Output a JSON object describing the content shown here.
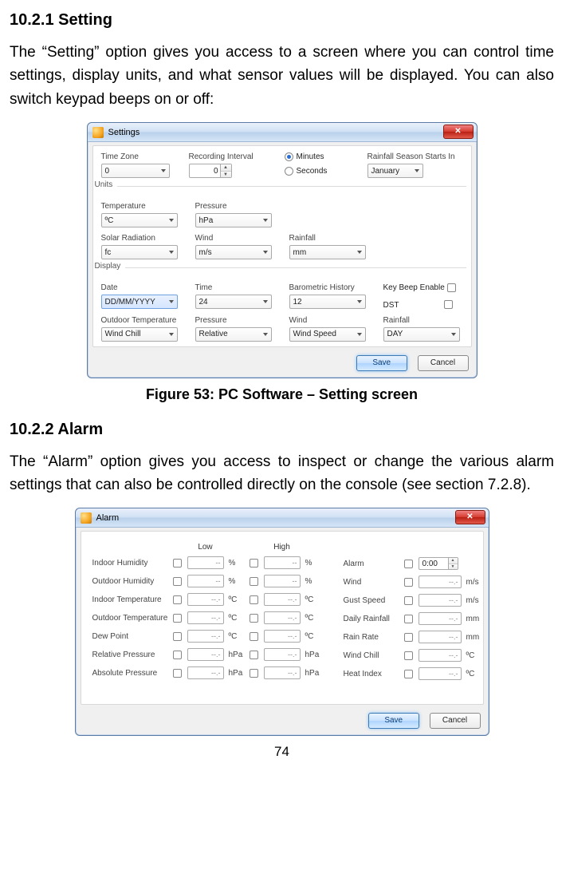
{
  "sections": {
    "setting": {
      "heading": "10.2.1 Setting",
      "paragraph": "The “Setting” option gives you access to a screen where you can control time settings, display units, and what sensor values will be displayed. You can also switch keypad beeps on or off:",
      "figcaption": "Figure 53: PC Software – Setting screen"
    },
    "alarm": {
      "heading": "10.2.2 Alarm",
      "paragraph": "The “Alarm” option gives you access to inspect or change the various alarm settings that can also be controlled directly on the console (see section 7.2.8)."
    }
  },
  "page_number": "74",
  "settings_window": {
    "title": "Settings",
    "close": "✕",
    "top": {
      "timezone_label": "Time Zone",
      "timezone_value": "0",
      "rec_interval_label": "Recording Interval",
      "rec_interval_value": "0",
      "minutes_label": "Minutes",
      "seconds_label": "Seconds",
      "rain_season_label": "Rainfall Season Starts In",
      "rain_season_value": "January"
    },
    "units": {
      "group_label": "Units",
      "temperature_label": "Temperature",
      "temperature_value": "ºC",
      "pressure_label": "Pressure",
      "pressure_value": "hPa",
      "solar_label": "Solar Radiation",
      "solar_value": "fc",
      "wind_label": "Wind",
      "wind_value": "m/s",
      "rainfall_label": "Rainfall",
      "rainfall_value": "mm"
    },
    "display": {
      "group_label": "Display",
      "date_label": "Date",
      "date_value": "DD/MM/YYYY",
      "time_label": "Time",
      "time_value": "24",
      "baro_label": "Barometric History",
      "baro_value": "12",
      "keybeep_label": "Key Beep Enable",
      "dst_label": "DST",
      "outdoor_temp_label": "Outdoor Temperature",
      "outdoor_temp_value": "Wind Chill",
      "pressure_label": "Pressure",
      "pressure_value": "Relative",
      "wind_label": "Wind",
      "wind_value": "Wind Speed",
      "rainfall_label": "Rainfall",
      "rainfall_value": "DAY"
    },
    "buttons": {
      "save": "Save",
      "cancel": "Cancel"
    }
  },
  "alarm_window": {
    "title": "Alarm",
    "close": "✕",
    "headers": {
      "low": "Low",
      "high": "High"
    },
    "placeholder_pct": "--",
    "placeholder_num": "--.-",
    "left_rows": [
      {
        "label": "Indoor Humidity",
        "unit": "%"
      },
      {
        "label": "Outdoor Humidity",
        "unit": "%"
      },
      {
        "label": "Indoor Temperature",
        "unit": "ºC"
      },
      {
        "label": "Outdoor Temperature",
        "unit": "ºC"
      },
      {
        "label": "Dew Point",
        "unit": "ºC"
      },
      {
        "label": "Relative Pressure",
        "unit": "hPa"
      },
      {
        "label": "Absolute Pressure",
        "unit": "hPa"
      }
    ],
    "right_rows": [
      {
        "label": "Alarm",
        "value": "0:00",
        "unit": "",
        "is_time": true
      },
      {
        "label": "Wind",
        "value": "--.-",
        "unit": "m/s"
      },
      {
        "label": "Gust Speed",
        "value": "--.-",
        "unit": "m/s"
      },
      {
        "label": "Daily Rainfall",
        "value": "--.-",
        "unit": "mm"
      },
      {
        "label": "Rain Rate",
        "value": "--.-",
        "unit": "mm"
      },
      {
        "label": "Wind Chill",
        "value": "--.-",
        "unit": "ºC"
      },
      {
        "label": "Heat Index",
        "value": "--.-",
        "unit": "ºC"
      }
    ],
    "buttons": {
      "save": "Save",
      "cancel": "Cancel"
    }
  }
}
